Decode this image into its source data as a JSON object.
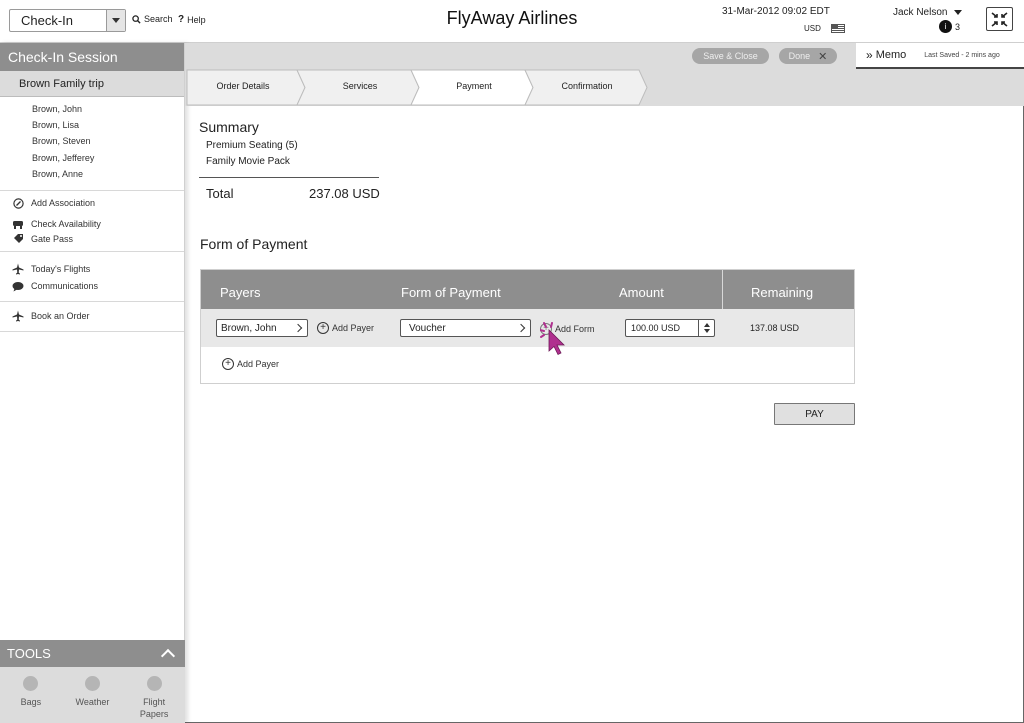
{
  "header": {
    "mode_select": "Check-In",
    "search_label": "Search",
    "help_label": "Help",
    "app_title": "FlyAway Airlines",
    "datetime": "31-Mar-2012  09:02 EDT",
    "currency": "USD",
    "user_name": "Jack Nelson",
    "notification_count": "3"
  },
  "sidebar": {
    "session_title": "Check-In Session",
    "trip_name": "Brown Family trip",
    "members": [
      "Brown, John",
      "Brown, Lisa",
      "Brown, Steven",
      "Brown, Jefferey",
      "Brown, Anne"
    ],
    "group1": [
      {
        "label": "Add Association",
        "icon": "link-icon"
      },
      {
        "label": "Check Availability",
        "icon": "seat-icon"
      },
      {
        "label": "Gate Pass",
        "icon": "tag-icon"
      }
    ],
    "group2": [
      {
        "label": "Today's Flights",
        "icon": "airplane-icon"
      },
      {
        "label": "Communications",
        "icon": "chat-bubble-icon"
      }
    ],
    "group3": [
      {
        "label": "Book an Order",
        "icon": "airplane-icon"
      }
    ],
    "tools_title": "TOOLS",
    "tools": [
      "Bags",
      "Weather",
      "Flight Papers"
    ]
  },
  "actions": {
    "save_close": "Save & Close",
    "done": "Done",
    "memo": "Memo",
    "last_saved": "Last Saved - 2 mins ago"
  },
  "steps": [
    "Order Details",
    "Services",
    "Payment",
    "Confirmation"
  ],
  "active_step": "Payment",
  "summary": {
    "title": "Summary",
    "items": [
      "Premium Seating (5)",
      "Family Movie Pack"
    ],
    "total_label": "Total",
    "total_value": "237.08 USD"
  },
  "payment": {
    "title": "Form of Payment",
    "columns": [
      "Payers",
      "Form of Payment",
      "Amount",
      "Remaining"
    ],
    "row": {
      "payer": "Brown, John",
      "add_payer_inline": "Add Payer",
      "form": "Voucher",
      "add_form": "Add Form",
      "amount": "100.00 USD",
      "remaining": "137.08 USD"
    },
    "add_payer": "Add Payer",
    "pay_button": "PAY"
  },
  "colors": {
    "header_gray": "#8e8e8e",
    "panel_gray": "#dcdcdc",
    "cursor_accent": "#b0308f"
  }
}
